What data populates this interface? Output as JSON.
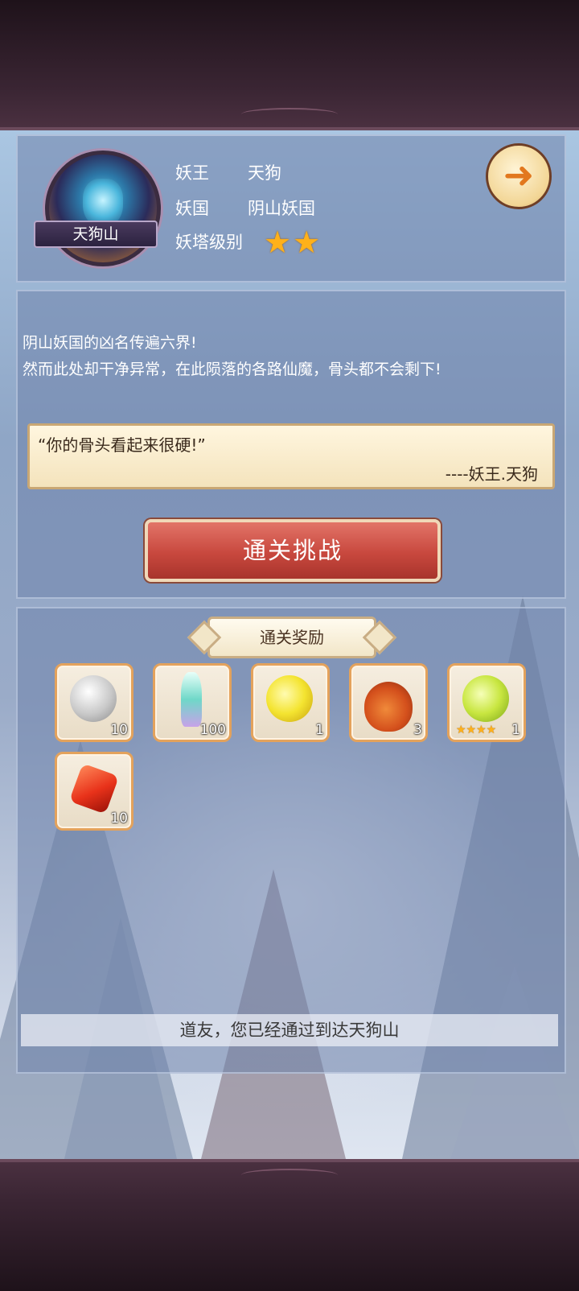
{
  "header": {
    "avatar_label": "天狗山",
    "rows": [
      {
        "key": "妖王",
        "value": "天狗"
      },
      {
        "key": "妖国",
        "value": "阴山妖国"
      },
      {
        "key": "妖塔级别",
        "stars": 2
      }
    ]
  },
  "description": {
    "line1": "阴山妖国的凶名传遍六界!",
    "line2": "然而此处却干净异常，在此陨落的各路仙魔，骨头都不会剩下!"
  },
  "quote": {
    "text": "“你的骨头看起来很硬!”",
    "author": "----妖王.天狗"
  },
  "challenge_button": "通关挑战",
  "rewards": {
    "title": "通关奖励",
    "items": [
      {
        "icon": "silver-orb-icon",
        "count": "10"
      },
      {
        "icon": "crystal-sword-icon",
        "count": "100"
      },
      {
        "icon": "golden-orb-icon",
        "count": "1"
      },
      {
        "icon": "gourd-icon",
        "count": "3"
      },
      {
        "icon": "green-spirit-orb-icon",
        "count": "1",
        "stars": 4
      },
      {
        "icon": "red-crystal-icon",
        "count": "10"
      }
    ]
  },
  "status_message": "道友，您已经通过到达天狗山"
}
